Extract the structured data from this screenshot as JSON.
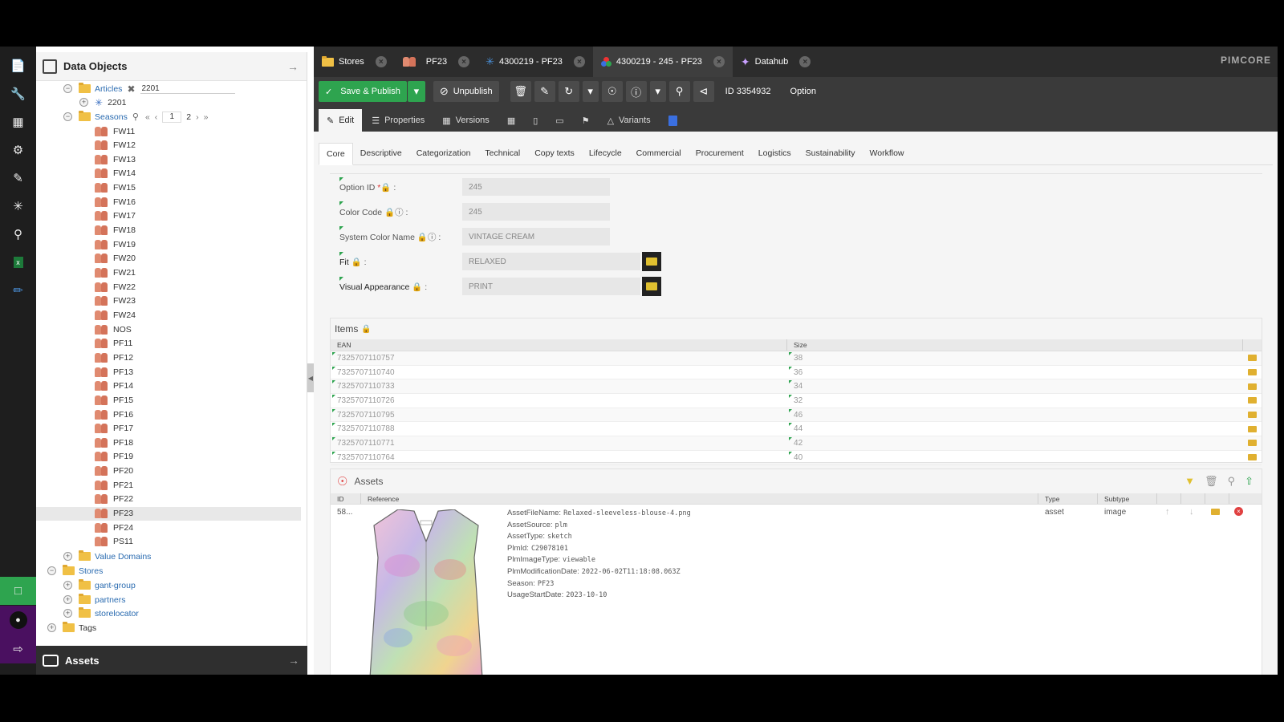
{
  "tree": {
    "title": "Data Objects",
    "articles_label": "Articles",
    "articles_filter": "2201",
    "articles_child": "2201",
    "seasons_label": "Seasons",
    "pager": {
      "current": "1",
      "next": "2"
    },
    "seasons": [
      "FW11",
      "FW12",
      "FW13",
      "FW14",
      "FW15",
      "FW16",
      "FW17",
      "FW18",
      "FW19",
      "FW20",
      "FW21",
      "FW22",
      "FW23",
      "FW24",
      "NOS",
      "PF11",
      "PF12",
      "PF13",
      "PF14",
      "PF15",
      "PF16",
      "PF17",
      "PF18",
      "PF19",
      "PF20",
      "PF21",
      "PF22",
      "PF23",
      "PF24",
      "PS11"
    ],
    "selected_season": "PF23",
    "value_domains": "Value Domains",
    "stores": "Stores",
    "stores_children": [
      "gant-group",
      "partners",
      "storelocator"
    ],
    "tags": "Tags",
    "assets_panel": "Assets"
  },
  "tabs": [
    {
      "label": "Stores"
    },
    {
      "label": "PF23"
    },
    {
      "label": "4300219 - PF23"
    },
    {
      "label": "4300219 - 245 - PF23"
    },
    {
      "label": "Datahub"
    }
  ],
  "brand": "PIMCORE",
  "toolbar": {
    "save_publish": "Save & Publish",
    "unpublish": "Unpublish",
    "id_text": "ID 3354932",
    "class_text": "Option"
  },
  "subtabs": {
    "edit": "Edit",
    "properties": "Properties",
    "versions": "Versions",
    "variants": "Variants"
  },
  "content_tabs": [
    "Core",
    "Descriptive",
    "Categorization",
    "Technical",
    "Copy texts",
    "Lifecycle",
    "Commercial",
    "Procurement",
    "Logistics",
    "Sustainability",
    "Workflow"
  ],
  "form": {
    "option_id": {
      "label": "Option ID",
      "value": "245"
    },
    "color_code": {
      "label": "Color Code",
      "value": "245"
    },
    "system_color_name": {
      "label": "System Color Name",
      "value": "VINTAGE CREAM"
    },
    "fit": {
      "label": "Fit",
      "value": "RELAXED"
    },
    "visual_appearance": {
      "label": "Visual Appearance",
      "value": "PRINT"
    }
  },
  "items": {
    "title": "Items",
    "col_ean": "EAN",
    "col_size": "Size",
    "rows": [
      {
        "ean": "7325707110757",
        "size": "38"
      },
      {
        "ean": "7325707110740",
        "size": "36"
      },
      {
        "ean": "7325707110733",
        "size": "34"
      },
      {
        "ean": "7325707110726",
        "size": "32"
      },
      {
        "ean": "7325707110795",
        "size": "46"
      },
      {
        "ean": "7325707110788",
        "size": "44"
      },
      {
        "ean": "7325707110771",
        "size": "42"
      },
      {
        "ean": "7325707110764",
        "size": "40"
      }
    ]
  },
  "assets": {
    "title": "Assets",
    "col_id": "ID",
    "col_reference": "Reference",
    "col_type": "Type",
    "col_subtype": "Subtype",
    "row": {
      "id": "58...",
      "type": "asset",
      "subtype": "image",
      "meta": [
        {
          "k": "AssetFileName:",
          "v": "Relaxed-sleeveless-blouse-4.png"
        },
        {
          "k": "AssetSource:",
          "v": "plm"
        },
        {
          "k": "AssetType:",
          "v": "sketch"
        },
        {
          "k": "PlmId:",
          "v": "C29078101"
        },
        {
          "k": "PlmImageType:",
          "v": "viewable"
        },
        {
          "k": "PlmModificationDate:",
          "v": "2022-06-02T11:18:08.063Z"
        },
        {
          "k": "Season:",
          "v": "PF23"
        },
        {
          "k": "UsageStartDate:",
          "v": "2023-10-10"
        }
      ]
    }
  },
  "colors": {
    "publish_green": "#2ea44f",
    "folder": "#f0c045",
    "link": "#2a6bb0"
  }
}
